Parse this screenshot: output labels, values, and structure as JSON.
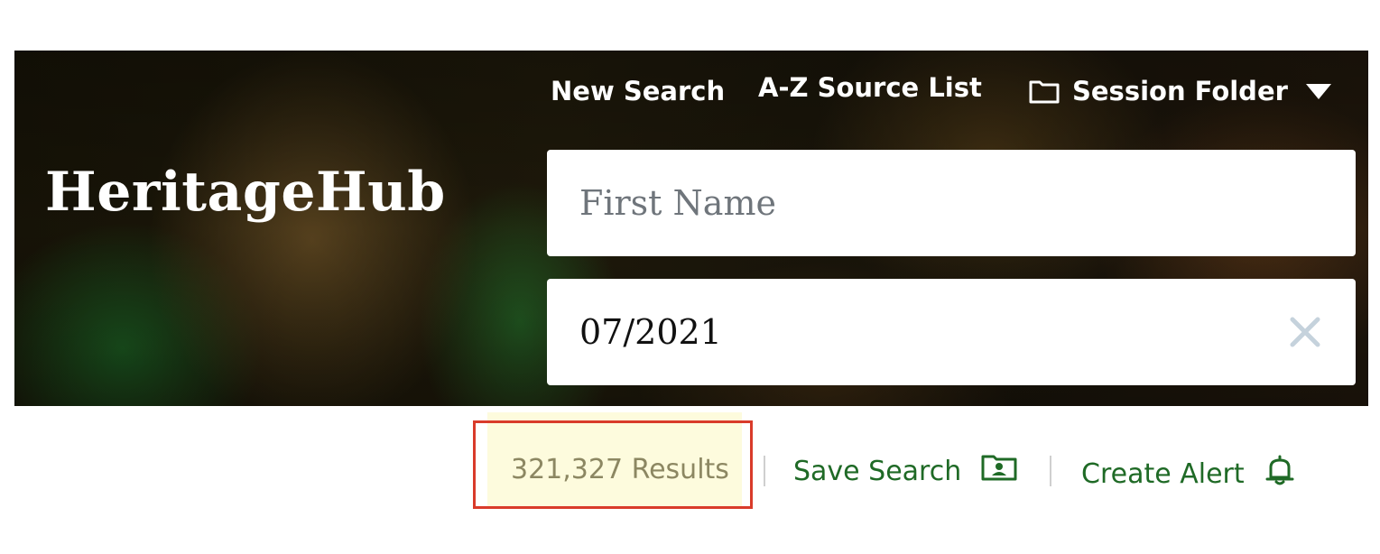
{
  "brand": {
    "name": "HeritageHub"
  },
  "nav": {
    "new_search": "New Search",
    "az_source_list": "A-Z Source List",
    "session_folder": "Session Folder"
  },
  "search": {
    "first_name": {
      "placeholder": "First Name",
      "value": ""
    },
    "date": {
      "value": "07/2021"
    }
  },
  "results": {
    "count_label": "321,327 Results",
    "save_search": "Save Search",
    "create_alert": "Create Alert"
  },
  "icons": {
    "folder": "folder-icon",
    "caret": "caret-down-icon",
    "clear": "close-icon",
    "save": "contact-card-folder-icon",
    "alert": "bell-icon"
  },
  "colors": {
    "action_green": "#1f6a26",
    "results_text": "#8c8762",
    "highlight_bg": "#fdfbdd",
    "focus_border": "#d93b2a",
    "clear_icon": "#c5d2dc"
  }
}
